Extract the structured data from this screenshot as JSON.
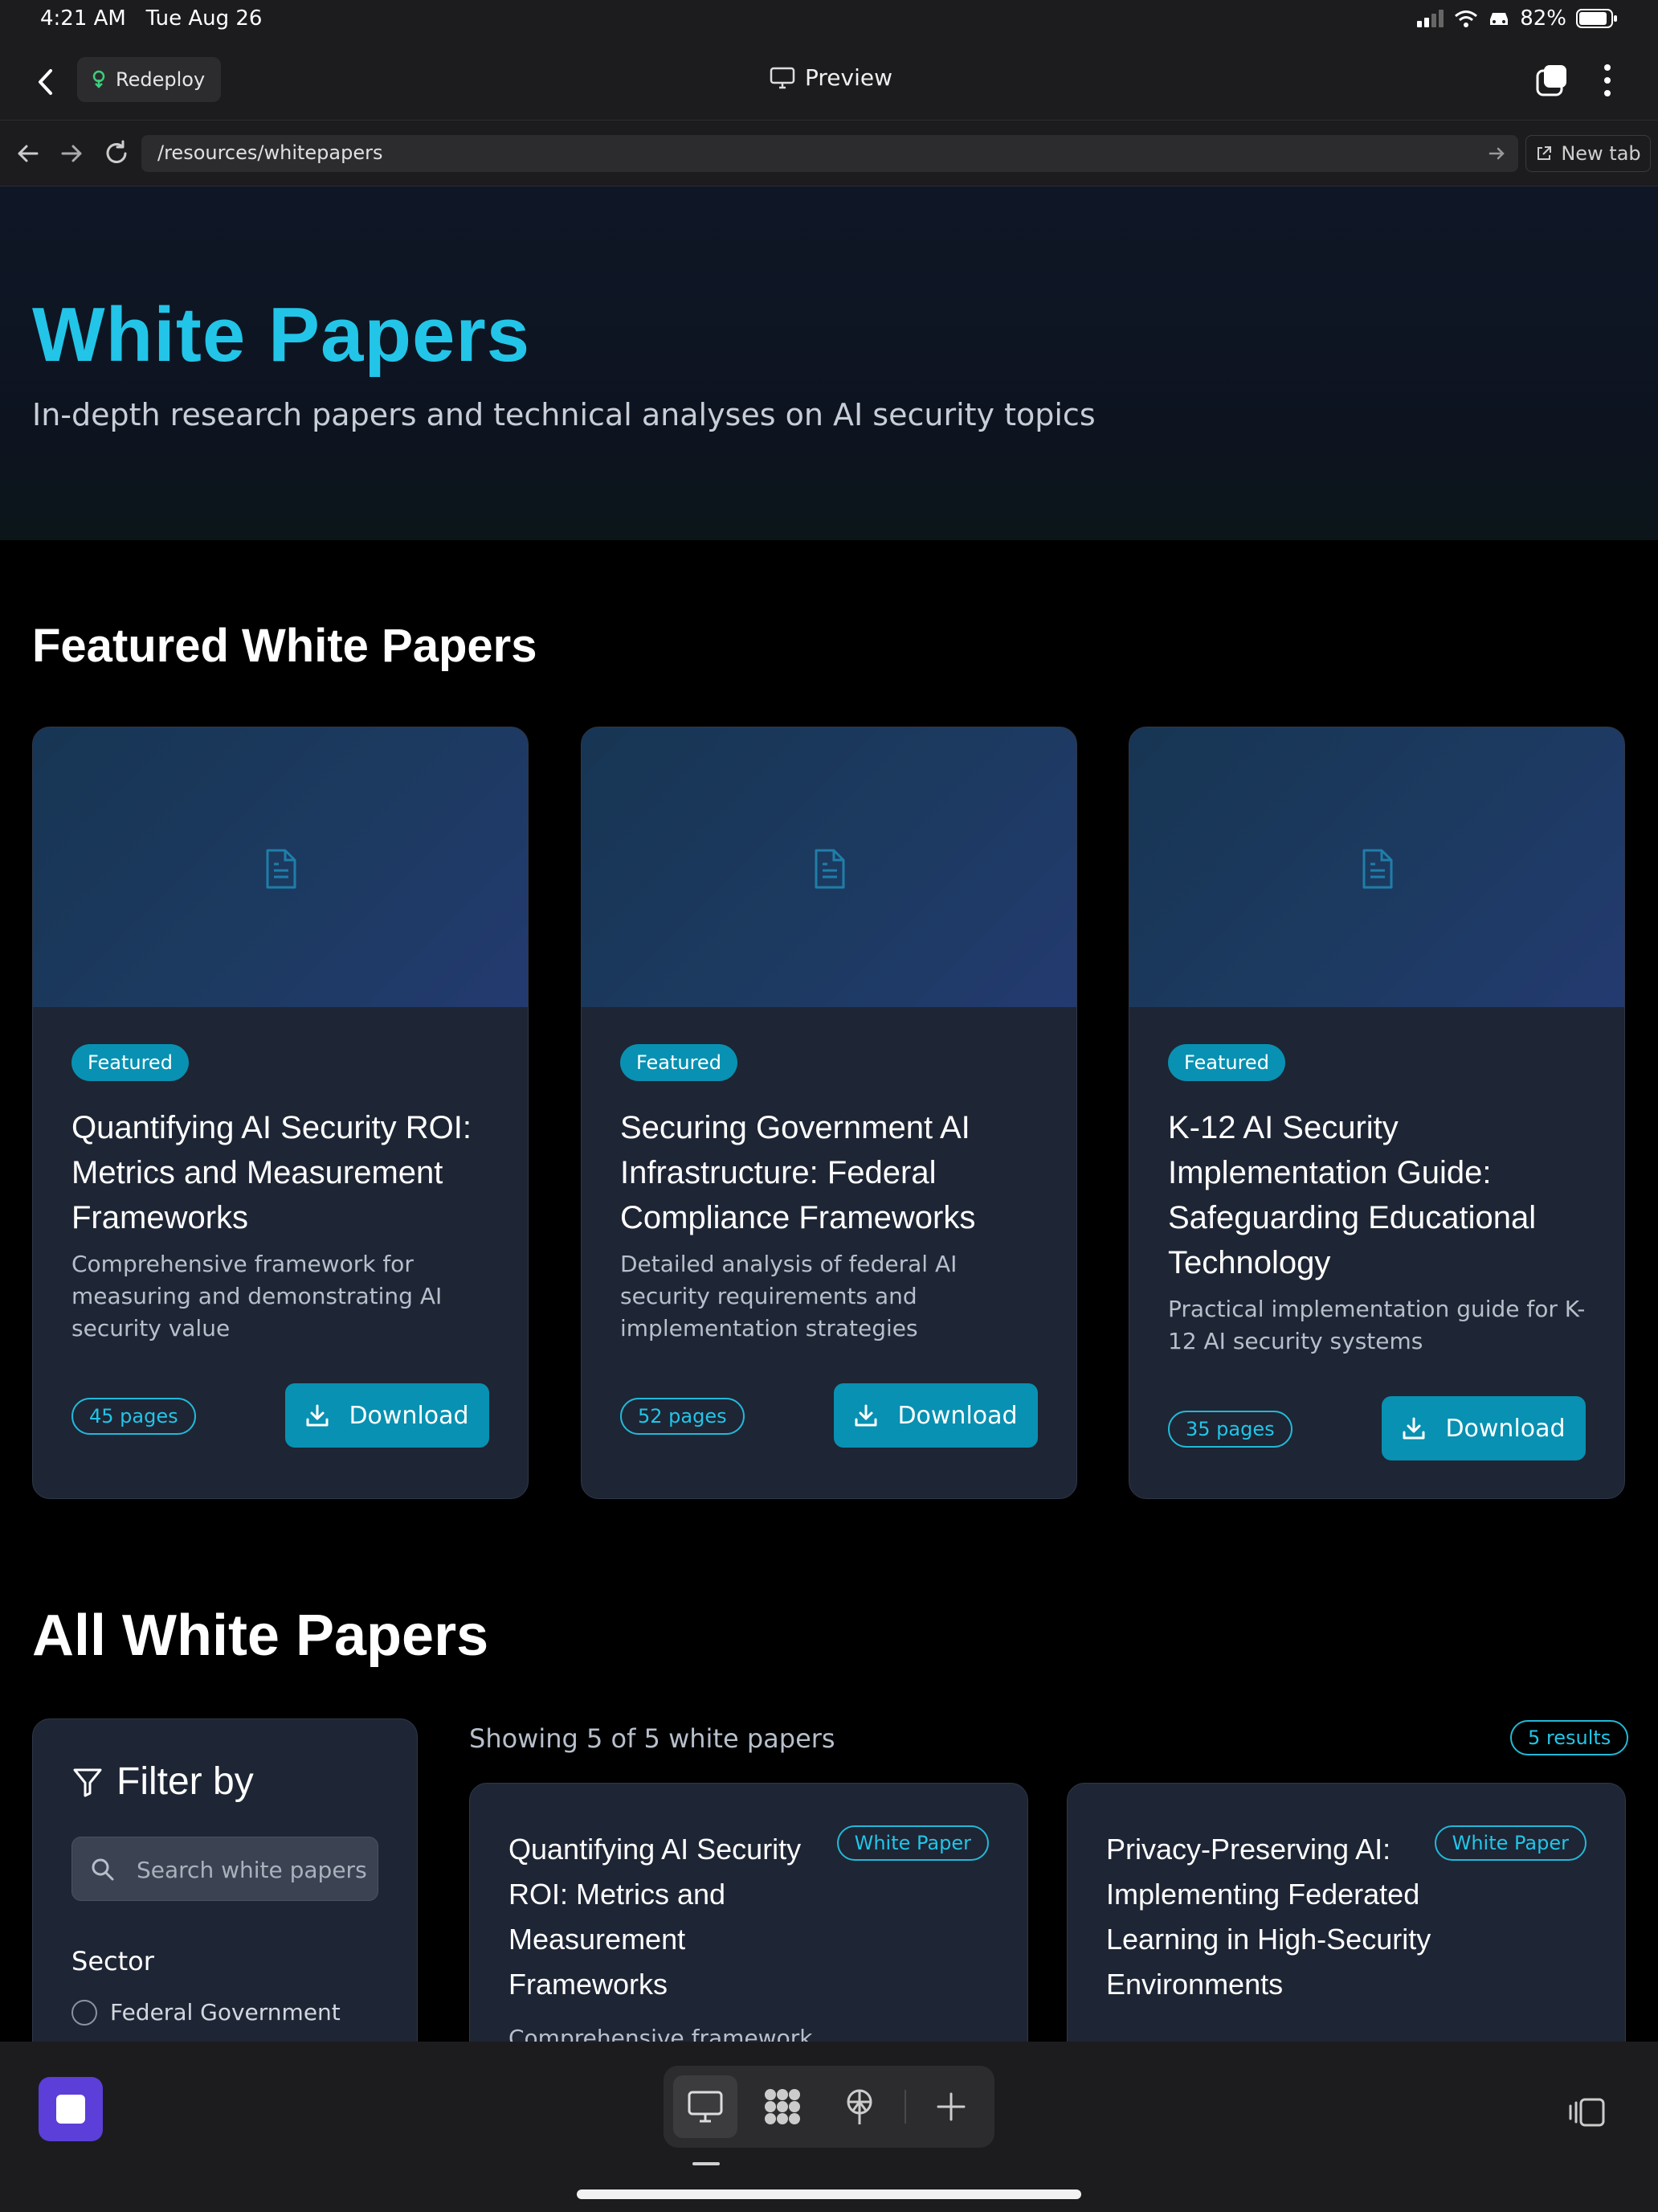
{
  "status": {
    "time": "4:21 AM",
    "date": "Tue Aug 26",
    "battery": "82%"
  },
  "toolbar": {
    "redeploy_label": "Redeploy",
    "preview_label": "Preview"
  },
  "urlbar": {
    "url": "/resources/whitepapers",
    "new_tab_label": "New tab"
  },
  "hero": {
    "title": "White Papers",
    "subtitle": "In-depth research papers and technical analyses on AI security topics"
  },
  "featured": {
    "heading": "Featured White Papers",
    "cards": [
      {
        "badge": "Featured",
        "title": "Quantifying AI Security ROI: Metrics and Measurement Frameworks",
        "description": "Comprehensive framework for measuring and demonstrating AI security value",
        "pages": "45 pages",
        "download_label": "Download"
      },
      {
        "badge": "Featured",
        "title": "Securing Government AI Infrastructure: Federal Compliance Frameworks",
        "description": "Detailed analysis of federal AI security requirements and implementation strategies",
        "pages": "52 pages",
        "download_label": "Download"
      },
      {
        "badge": "Featured",
        "title": "K-12 AI Security Implementation Guide: Safeguarding Educational Technology",
        "description": "Practical implementation guide for K-12 AI security systems",
        "pages": "35 pages",
        "download_label": "Download"
      }
    ]
  },
  "all": {
    "heading": "All White Papers",
    "filter": {
      "title": "Filter by",
      "search_placeholder": "Search white papers",
      "sector_label": "Sector",
      "sector_options": [
        "Federal Government"
      ]
    },
    "showing_text": "Showing 5 of 5 white papers",
    "results_badge": "5 results",
    "papers": [
      {
        "title": "Quantifying AI Security ROI: Metrics and Measurement Frameworks",
        "tag": "White Paper",
        "description": "Comprehensive framework"
      },
      {
        "title": "Privacy-Preserving AI: Implementing Federated Learning in High-Security Environments",
        "tag": "White Paper",
        "description": ""
      }
    ]
  },
  "colors": {
    "accent": "#22c5e8",
    "button": "#0891b2",
    "card_bg": "#1e2534",
    "app_icon": "#5b3fd8"
  },
  "icons": [
    "back-chevron-icon",
    "redeploy-icon",
    "monitor-icon",
    "tabs-icon",
    "more-icon",
    "arrow-left-icon",
    "arrow-right-icon",
    "reload-icon",
    "external-link-icon",
    "document-icon",
    "download-icon",
    "filter-icon",
    "search-icon",
    "flower-icon",
    "antenna-icon",
    "plus-icon",
    "sidebar-icon"
  ]
}
